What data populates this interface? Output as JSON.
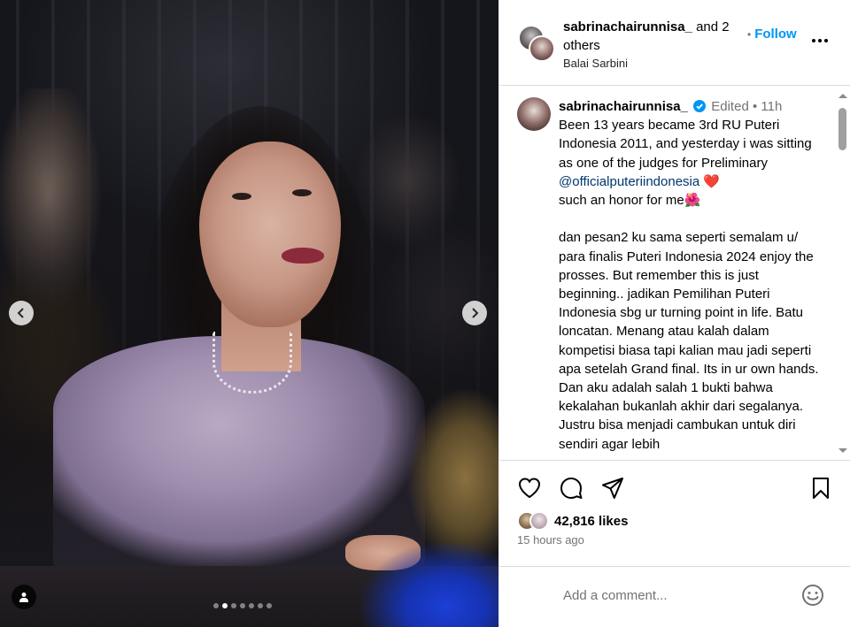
{
  "post": {
    "header": {
      "username": "sabrinachairunnisa_",
      "coauthors": "and 2 others",
      "location": "Balai Sarbini",
      "follow_label": "Follow",
      "follow_separator": "•"
    },
    "caption": {
      "username": "sabrinachairunnisa_",
      "edited_label": "Edited",
      "meta_separator": "•",
      "age": "11h",
      "text_part1": "Been 13 years became 3rd RU Puteri Indonesia 2011, and yesterday i was sitting as one of the judges for Preliminary ",
      "mention": "@officialputeriindonesia",
      "heart_emoji": "❤️",
      "text_part2": "such an honor for me",
      "flower_emoji": "🌺",
      "text_part3": "dan pesan2 ku sama seperti semalam u/ para finalis Puteri Indonesia 2024 enjoy the prosses. But remember this is just beginning.. jadikan Pemilihan Puteri Indonesia sbg ur turning point in life. Batu loncatan. Menang atau kalah dalam kompetisi biasa tapi kalian mau jadi seperti apa setelah Grand final. Its in ur own hands. Dan aku adalah salah 1 bukti bahwa kekalahan bukanlah akhir dari segalanya. Justru bisa menjadi cambukan untuk diri sendiri agar lebih"
    },
    "likes_count": "42,816 likes",
    "timestamp": "15 hours ago",
    "comment_placeholder": "Add a comment..."
  },
  "carousel": {
    "total_slides": 7,
    "active_index": 1
  },
  "icons": {
    "verified": "verified-badge-icon",
    "like": "heart-outline-icon",
    "comment": "comment-bubble-icon",
    "share": "paper-plane-icon",
    "save": "bookmark-icon",
    "more": "more-horizontal-icon",
    "emoji": "smiley-icon",
    "prev": "chevron-left-icon",
    "next": "chevron-right-icon",
    "tagged": "user-tag-icon"
  },
  "colors": {
    "link_blue": "#0095f6",
    "mention": "#00376b",
    "verified": "#0095f6",
    "secondary_text": "#737373"
  }
}
